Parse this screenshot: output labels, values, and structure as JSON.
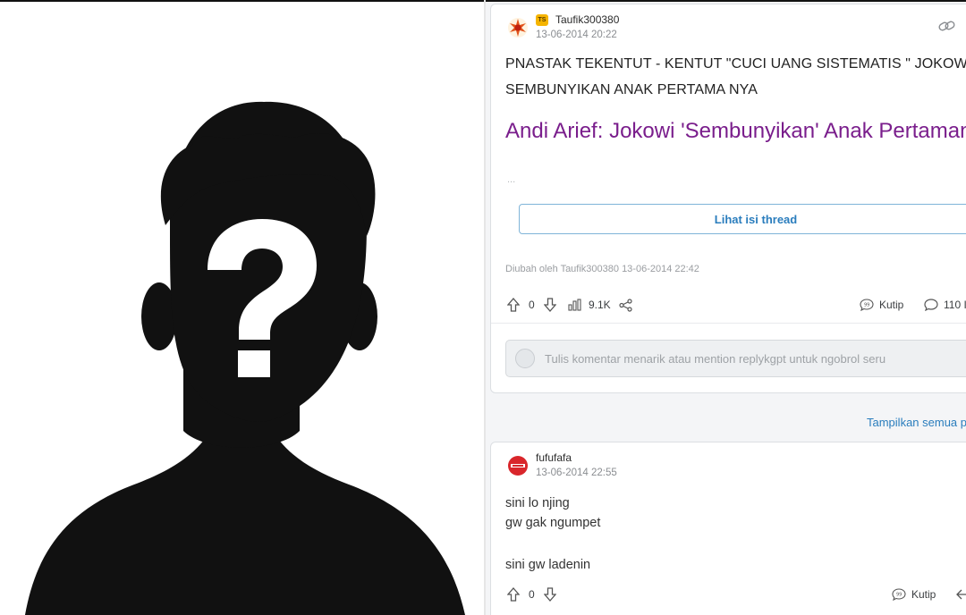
{
  "thread": {
    "op_badge": "TS",
    "username": "Taufik300380",
    "timestamp": "13-06-2014 20:22",
    "title_line1": "PNASTAK TEKENTUT - KENTUT \"CUCI UANG SISTEMATIS \" JOKOW",
    "title_line2": "SEMBUNYIKAN ANAK PERTAMA NYA",
    "article_title": "Andi Arief: Jokowi 'Sembunyikan' Anak Pertamanya",
    "ellipsis": "...",
    "view_button": "Lihat isi thread",
    "edited_note": "Diubah oleh Taufik300380 13-06-2014 22:42",
    "upvotes": "0",
    "views": "9.1K",
    "quote_label": "Kutip",
    "reply_count": "110 I"
  },
  "comment_input": {
    "placeholder": "Tulis komentar menarik atau mention replykgpt untuk ngobrol seru"
  },
  "show_all": "Tampilkan semua p",
  "reply": {
    "username": "fufufafa",
    "timestamp": "13-06-2014 22:55",
    "line1": "sini lo njing",
    "line2": "gw gak ngumpet",
    "line3": "sini gw ladenin",
    "upvotes": "0",
    "quote_label": "Kutip"
  },
  "colors": {
    "link": "#2a7dbd",
    "article_title": "#7a1e8c",
    "badge": "#f5b400"
  }
}
